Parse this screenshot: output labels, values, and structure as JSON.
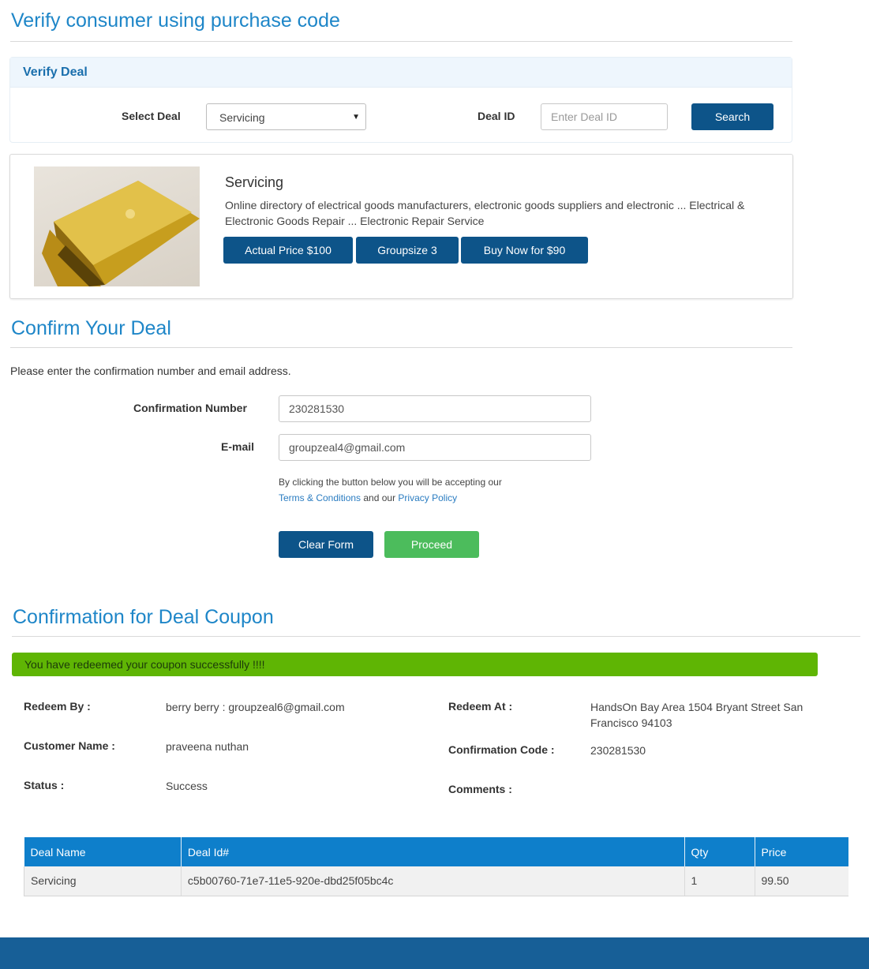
{
  "verify": {
    "title": "Verify consumer using purchase code",
    "panel_heading": "Verify Deal",
    "select_deal_label": "Select Deal",
    "select_deal_value": "Servicing",
    "deal_id_label": "Deal ID",
    "deal_id_placeholder": "Enter Deal ID",
    "search_label": "Search"
  },
  "deal": {
    "name": "Servicing",
    "description": "Online directory of electrical goods manufacturers, electronic goods suppliers and electronic ... Electrical & Electronic Goods Repair ... Electronic Repair Service",
    "actual_price_label": "Actual Price $100",
    "groupsize_label": "Groupsize 3",
    "buy_now_label": "Buy Now for $90"
  },
  "confirm": {
    "title": "Confirm Your Deal",
    "instructions": "Please enter the confirmation number and email address.",
    "confirmation_number_label": "Confirmation Number",
    "confirmation_number_value": "230281530",
    "email_label": "E-mail",
    "email_value": "groupzeal4@gmail.com",
    "terms_prefix": "By clicking the button below you will be accepting our",
    "terms_link": "Terms & Conditions",
    "terms_and": " and our ",
    "privacy_link": "Privacy Policy",
    "clear_label": "Clear Form",
    "proceed_label": "Proceed"
  },
  "coupon": {
    "title": "Confirmation for Deal Coupon",
    "success_message": "You have redeemed your coupon successfully !!!!",
    "redeem_by_label": "Redeem By :",
    "redeem_by_value": "berry berry : groupzeal6@gmail.com",
    "customer_name_label": "Customer Name :",
    "customer_name_value": "praveena nuthan",
    "status_label": "Status :",
    "status_value": "Success",
    "redeem_at_label": "Redeem At :",
    "redeem_at_value": "HandsOn Bay Area 1504 Bryant Street San Francisco 94103",
    "confirmation_code_label": "Confirmation Code :",
    "confirmation_code_value": "230281530",
    "comments_label": "Comments :",
    "comments_value": ""
  },
  "table": {
    "headers": [
      "Deal Name",
      "Deal Id#",
      "Qty",
      "Price"
    ],
    "rows": [
      [
        "Servicing",
        "c5b00760-71e7-11e5-920e-dbd25f05bc4c",
        "1",
        "99.50"
      ]
    ]
  },
  "colors": {
    "heading_blue": "#1e86c8",
    "button_dark": "#0d5489",
    "button_green": "#4cbc5c",
    "alert_green": "#5fb504",
    "table_header": "#0e7fcb",
    "footer": "#175f97"
  }
}
